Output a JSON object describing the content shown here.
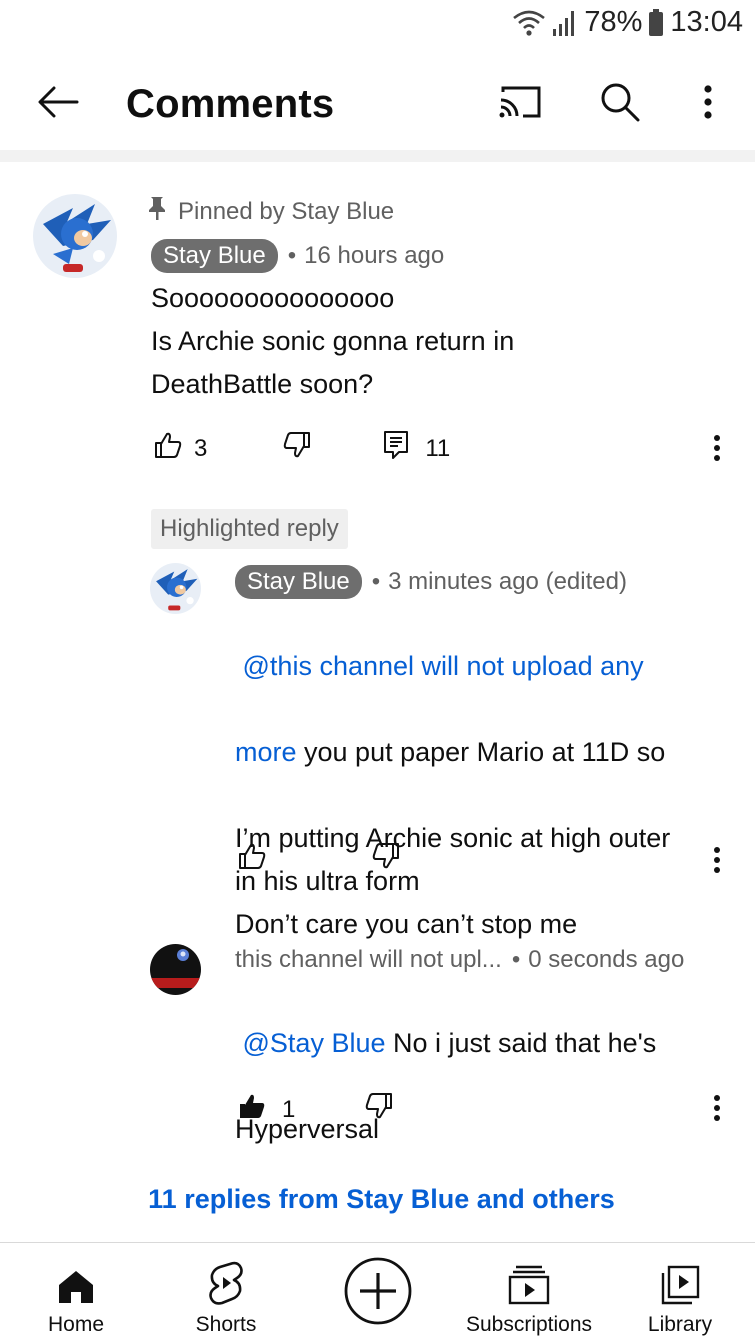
{
  "status_bar": {
    "battery": "78%",
    "time": "13:04"
  },
  "header": {
    "title": "Comments"
  },
  "pinned_comment": {
    "pinned_label": "Pinned by Stay Blue",
    "author": "Stay Blue",
    "time": "16 hours ago",
    "text": "Sooooooooooooooo\nIs Archie sonic gonna return in\nDeathBattle soon?",
    "likes": "3",
    "replies_count": "11"
  },
  "highlighted_label": "Highlighted reply",
  "reply_1": {
    "author": "Stay Blue",
    "time": "3 minutes ago (edited)",
    "mention_part1": "@this channel will not upload any",
    "mention_part2": "more",
    "text_line1": " you put paper Mario at 11D so",
    "text_rest": "I’m putting Archie sonic at high outer\nin his ultra form\nDon’t care you can’t stop me"
  },
  "reply_2": {
    "author": "this channel will not upl...",
    "time": "0 seconds ago",
    "mention": "@Stay Blue",
    "text_line1": " No i just said that he's",
    "text_rest": "Hyperversal",
    "likes": "1"
  },
  "more_replies_link": "11 replies from Stay Blue and others",
  "bottom_nav": {
    "home": "Home",
    "shorts": "Shorts",
    "subscriptions": "Subscriptions",
    "library": "Library"
  },
  "colors": {
    "link_blue": "#065fd4",
    "chip_grey": "#6e6e6e",
    "meta_grey": "#606060"
  },
  "icons": [
    "wifi-icon",
    "signal-icon",
    "battery-icon",
    "back-arrow-icon",
    "cast-icon",
    "search-icon",
    "more-vert-icon",
    "pin-icon",
    "thumb-up-icon",
    "thumb-down-icon",
    "reply-icon",
    "home-icon",
    "shorts-icon",
    "create-icon",
    "subscriptions-icon",
    "library-icon"
  ]
}
